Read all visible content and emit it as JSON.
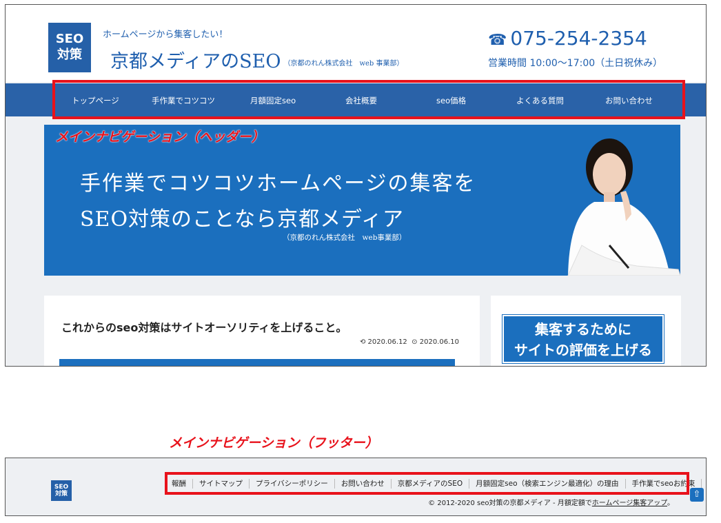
{
  "header": {
    "logo_line1": "SEO",
    "logo_line2": "対策",
    "tagline": "ホームページから集客したい！",
    "site_name": "京都メディアのSEO",
    "site_company": "（京都のれん株式会社　web 事業部）",
    "phone": "075-254-2354",
    "hours": "営業時間 10:00〜17:00（土日祝休み）",
    "phone_icon": "telephone-icon"
  },
  "nav": {
    "items": [
      "トップページ",
      "手作業でコツコツ",
      "月額固定seo",
      "会社概要",
      "seo価格",
      "よくある質問",
      "お問い合わせ"
    ]
  },
  "annotations": {
    "header_label": "メインナビゲーション（ヘッダー）",
    "footer_label": "メインナビゲーション（フッター）",
    "highlight_color": "#e8121b"
  },
  "hero": {
    "line1": "手作業でコツコツホームページの集客を",
    "line2": "SEO対策のことなら京都メディア",
    "line3": "（京都のれん株式会社　web事業部）"
  },
  "post": {
    "title": "これからのseo対策はサイトオーソリティを上げること。",
    "updated": "2020.06.12",
    "published": "2020.06.10"
  },
  "sidebar": {
    "banner_line1": "集客するために",
    "banner_line2": "サイトの評価を上げる"
  },
  "footer": {
    "logo_line1": "SEO",
    "logo_line2": "対策",
    "nav": [
      "報酬",
      "サイトマップ",
      "プライバシーポリシー",
      "お問い合わせ",
      "京都メディアのSEO",
      "月額固定seo（検索エンジン最適化）の理由",
      "手作業でseoお約束"
    ],
    "copyright": "© 2012-2020 seo対策の京都メディア - 月額定額で",
    "copyright_link": "ホームページ集客アップ",
    "copyright_end": "。"
  },
  "colors": {
    "brand_blue": "#2a62a8",
    "hero_blue": "#1b6fbe",
    "page_bg": "#eef0f3"
  }
}
